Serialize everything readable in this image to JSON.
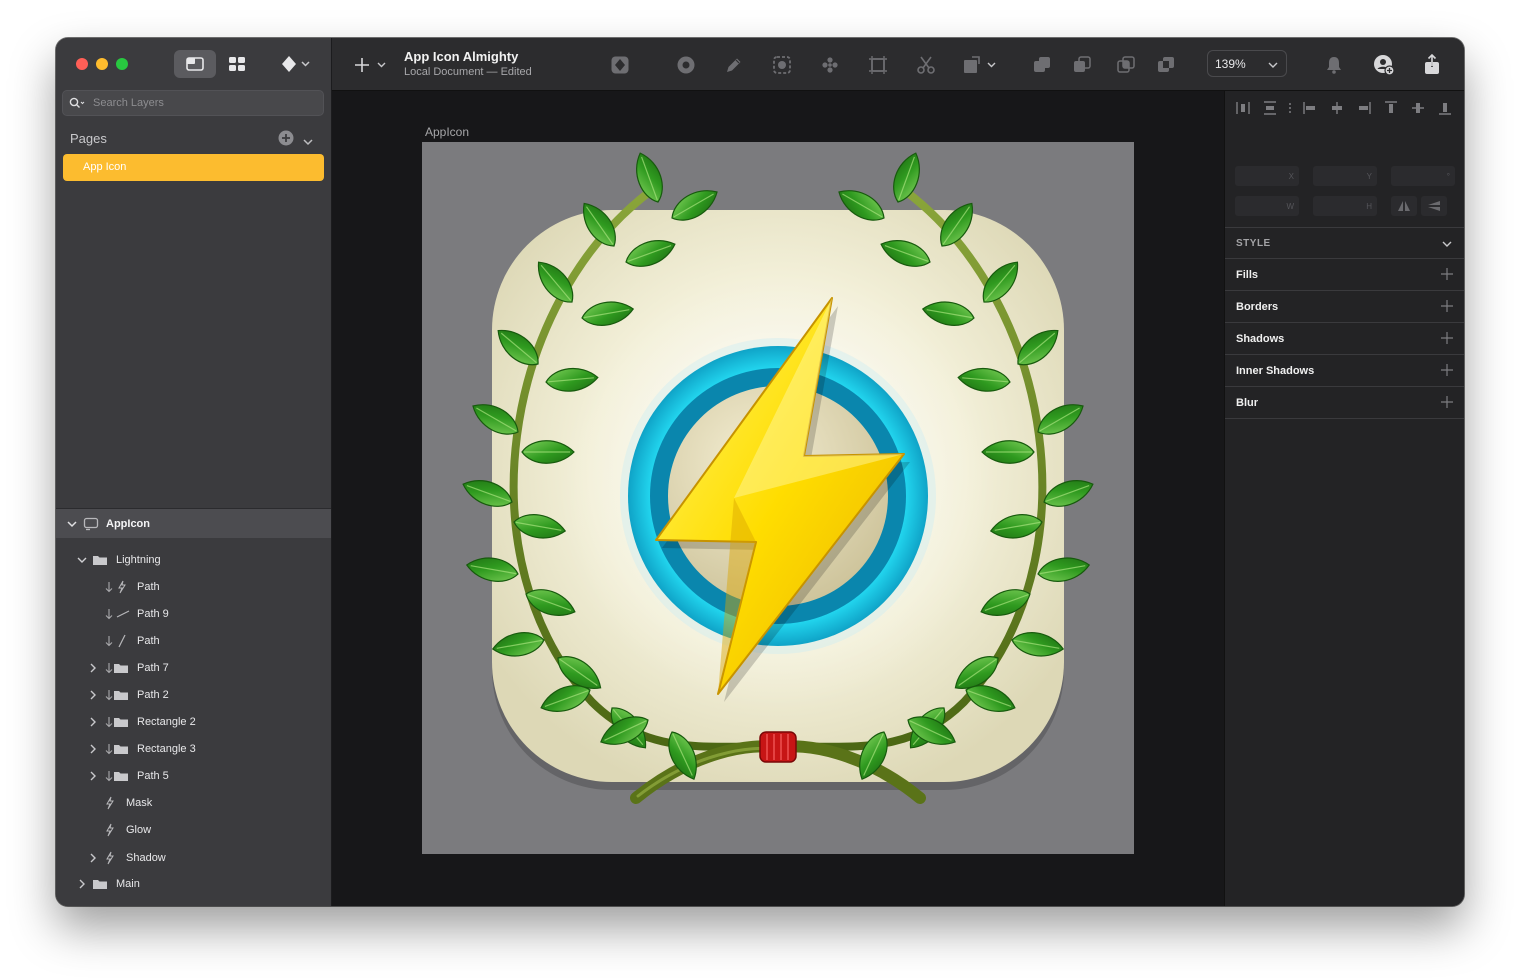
{
  "window": {
    "title": "App Icon Almighty",
    "subtitle": "Local Document — Edited"
  },
  "sidebar": {
    "search_placeholder": "Search Layers",
    "pages_title": "Pages",
    "pages": [
      {
        "label": "App Icon",
        "selected": true
      }
    ],
    "artboard": {
      "label": "AppIcon"
    },
    "layers": [
      {
        "label": "Lightning",
        "type": "group",
        "expanded": true
      },
      {
        "label": "Path",
        "type": "path"
      },
      {
        "label": "Path 9",
        "type": "path"
      },
      {
        "label": "Path",
        "type": "path"
      },
      {
        "label": "Path 7",
        "type": "group"
      },
      {
        "label": "Path 2",
        "type": "group"
      },
      {
        "label": "Rectangle 2",
        "type": "group"
      },
      {
        "label": "Rectangle 3",
        "type": "group"
      },
      {
        "label": "Path 5",
        "type": "group"
      },
      {
        "label": "Mask",
        "type": "symbol"
      },
      {
        "label": "Glow",
        "type": "symbol"
      },
      {
        "label": "Shadow",
        "type": "symbol"
      },
      {
        "label": "Main",
        "type": "group"
      }
    ]
  },
  "toolbar": {
    "zoom": "139%"
  },
  "canvas": {
    "artboard_label": "AppIcon"
  },
  "inspector": {
    "fields": {
      "x": "X",
      "y": "Y",
      "rotation": "°",
      "w": "W",
      "h": "H"
    },
    "style_header": "STYLE",
    "sections": [
      "Fills",
      "Borders",
      "Shadows",
      "Inner Shadows",
      "Blur"
    ]
  },
  "colors": {
    "accent": "#fcbc2f",
    "sidebar_bg": "#3b3b3e",
    "canvas_bg": "#171719",
    "artboard_bg": "#7b7b7e"
  }
}
